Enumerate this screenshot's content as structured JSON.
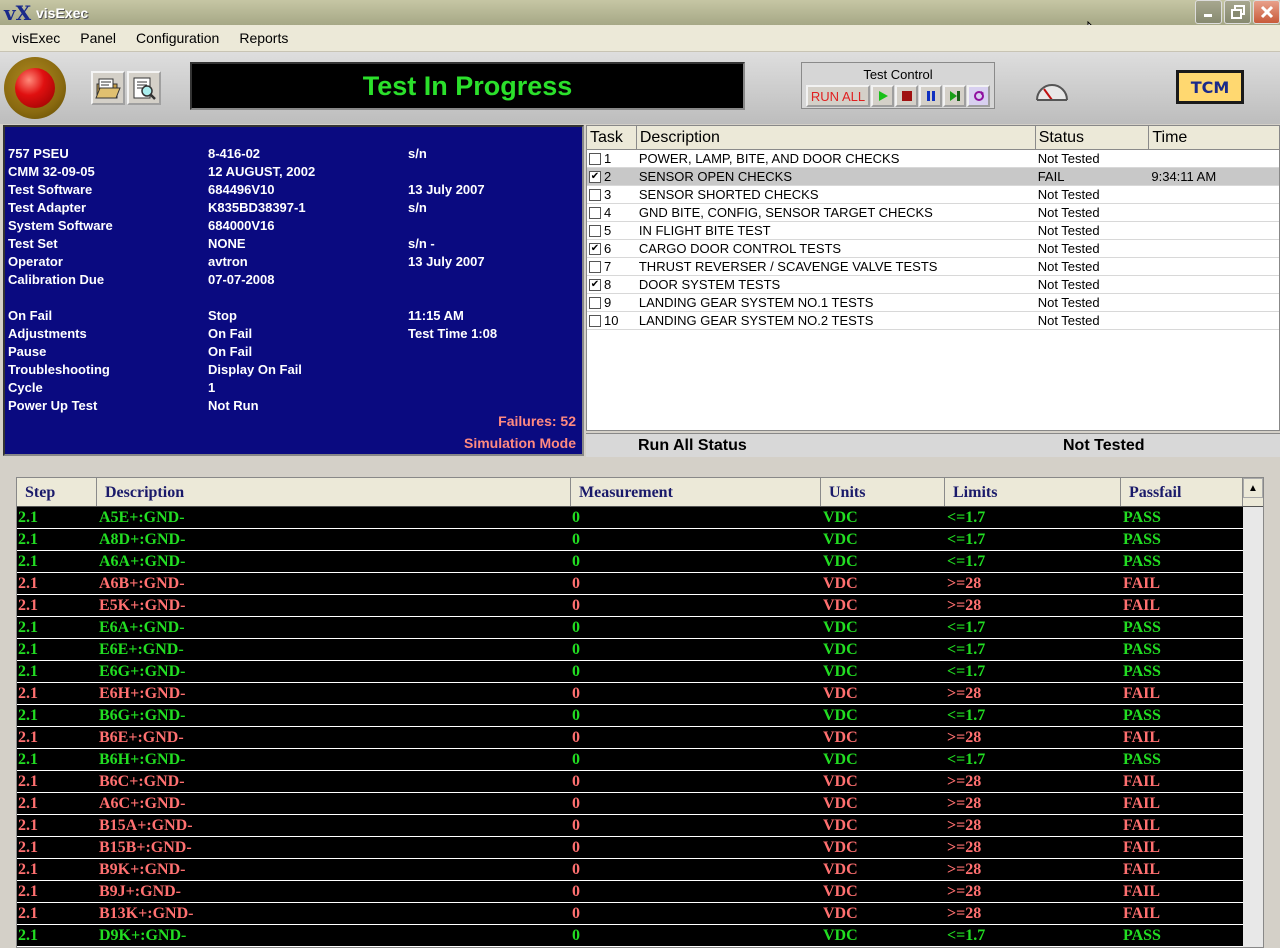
{
  "window": {
    "title": "visExec",
    "logo": "vX"
  },
  "menu": [
    "visExec",
    "Panel",
    "Configuration",
    "Reports"
  ],
  "toolbar": {
    "status_text": "Test In Progress",
    "test_control_title": "Test Control",
    "run_all_label": "RUN ALL",
    "tcm_label": "TCM"
  },
  "info": {
    "rows": [
      {
        "c1": "757 PSEU",
        "c2": "8-416-02",
        "c3": "s/n"
      },
      {
        "c1": "CMM 32-09-05",
        "c2": "12 AUGUST, 2002",
        "c3": ""
      },
      {
        "c1": "Test Software",
        "c2": "684496V10",
        "c3": "13 July  2007"
      },
      {
        "c1": "Test Adapter",
        "c2": "K835BD38397-1",
        "c3": "s/n"
      },
      {
        "c1": "System Software",
        "c2": "684000V16",
        "c3": ""
      },
      {
        "c1": "Test Set",
        "c2": "NONE",
        "c3": "s/n -"
      },
      {
        "c1": "Operator",
        "c2": "avtron",
        "c3": "13 July  2007"
      },
      {
        "c1": "Calibration Due",
        "c2": "07-07-2008",
        "c3": ""
      },
      {
        "c1": "On Fail",
        "c2": "Stop",
        "c3": "11:15 AM"
      },
      {
        "c1": "Adjustments",
        "c2": "On Fail",
        "c3": "Test Time  1:08"
      },
      {
        "c1": "Pause",
        "c2": "On Fail",
        "c3": ""
      },
      {
        "c1": "Troubleshooting",
        "c2": "Display On Fail",
        "c3": ""
      },
      {
        "c1": "Cycle",
        "c2": "1",
        "c3": ""
      },
      {
        "c1": "Power Up Test",
        "c2": "Not Run",
        "c3": ""
      }
    ],
    "failures": "Failures: 52",
    "mode": "Simulation Mode"
  },
  "tasks": {
    "headers": [
      "Task",
      "Description",
      "Status",
      "Time"
    ],
    "rows": [
      {
        "num": "1",
        "checked": false,
        "desc": "POWER, LAMP, BITE, AND DOOR CHECKS",
        "status": "Not Tested",
        "time": ""
      },
      {
        "num": "2",
        "checked": true,
        "desc": "SENSOR OPEN CHECKS",
        "status": "FAIL",
        "time": "9:34:11 AM",
        "selected": true
      },
      {
        "num": "3",
        "checked": false,
        "desc": "SENSOR SHORTED CHECKS",
        "status": "Not Tested",
        "time": ""
      },
      {
        "num": "4",
        "checked": false,
        "desc": "GND BITE, CONFIG, SENSOR TARGET CHECKS",
        "status": "Not Tested",
        "time": ""
      },
      {
        "num": "5",
        "checked": false,
        "desc": "IN FLIGHT BITE TEST",
        "status": "Not Tested",
        "time": ""
      },
      {
        "num": "6",
        "checked": true,
        "desc": "CARGO DOOR CONTROL TESTS",
        "status": "Not Tested",
        "time": ""
      },
      {
        "num": "7",
        "checked": false,
        "desc": "THRUST REVERSER / SCAVENGE VALVE TESTS",
        "status": "Not Tested",
        "time": ""
      },
      {
        "num": "8",
        "checked": true,
        "desc": "DOOR SYSTEM TESTS",
        "status": "Not Tested",
        "time": ""
      },
      {
        "num": "9",
        "checked": false,
        "desc": "LANDING GEAR SYSTEM NO.1 TESTS",
        "status": "Not Tested",
        "time": ""
      },
      {
        "num": "10",
        "checked": false,
        "desc": "LANDING GEAR SYSTEM NO.2 TESTS",
        "status": "Not Tested",
        "time": ""
      }
    ],
    "run_all_label": "Run All Status",
    "run_all_value": "Not Tested"
  },
  "steps": {
    "headers": [
      "Step",
      "Description",
      "Measurement",
      "Units",
      "Limits",
      "Passfail"
    ],
    "rows": [
      {
        "step": "2.1",
        "desc": "A5E+:GND-",
        "meas": "0",
        "units": "VDC",
        "limits": "<=1.7",
        "pf": "PASS"
      },
      {
        "step": "2.1",
        "desc": "A8D+:GND-",
        "meas": "0",
        "units": "VDC",
        "limits": "<=1.7",
        "pf": "PASS"
      },
      {
        "step": "2.1",
        "desc": "A6A+:GND-",
        "meas": "0",
        "units": "VDC",
        "limits": "<=1.7",
        "pf": "PASS"
      },
      {
        "step": "2.1",
        "desc": "A6B+:GND-",
        "meas": "0",
        "units": "VDC",
        "limits": ">=28",
        "pf": "FAIL"
      },
      {
        "step": "2.1",
        "desc": "E5K+:GND-",
        "meas": "0",
        "units": "VDC",
        "limits": ">=28",
        "pf": "FAIL"
      },
      {
        "step": "2.1",
        "desc": "E6A+:GND-",
        "meas": "0",
        "units": "VDC",
        "limits": "<=1.7",
        "pf": "PASS"
      },
      {
        "step": "2.1",
        "desc": "E6E+:GND-",
        "meas": "0",
        "units": "VDC",
        "limits": "<=1.7",
        "pf": "PASS"
      },
      {
        "step": "2.1",
        "desc": "E6G+:GND-",
        "meas": "0",
        "units": "VDC",
        "limits": "<=1.7",
        "pf": "PASS"
      },
      {
        "step": "2.1",
        "desc": "E6H+:GND-",
        "meas": "0",
        "units": "VDC",
        "limits": ">=28",
        "pf": "FAIL"
      },
      {
        "step": "2.1",
        "desc": "B6G+:GND-",
        "meas": "0",
        "units": "VDC",
        "limits": "<=1.7",
        "pf": "PASS"
      },
      {
        "step": "2.1",
        "desc": "B6E+:GND-",
        "meas": "0",
        "units": "VDC",
        "limits": ">=28",
        "pf": "FAIL"
      },
      {
        "step": "2.1",
        "desc": "B6H+:GND-",
        "meas": "0",
        "units": "VDC",
        "limits": "<=1.7",
        "pf": "PASS"
      },
      {
        "step": "2.1",
        "desc": "B6C+:GND-",
        "meas": "0",
        "units": "VDC",
        "limits": ">=28",
        "pf": "FAIL"
      },
      {
        "step": "2.1",
        "desc": "A6C+:GND-",
        "meas": "0",
        "units": "VDC",
        "limits": ">=28",
        "pf": "FAIL"
      },
      {
        "step": "2.1",
        "desc": "B15A+:GND-",
        "meas": "0",
        "units": "VDC",
        "limits": ">=28",
        "pf": "FAIL"
      },
      {
        "step": "2.1",
        "desc": "B15B+:GND-",
        "meas": "0",
        "units": "VDC",
        "limits": ">=28",
        "pf": "FAIL"
      },
      {
        "step": "2.1",
        "desc": "B9K+:GND-",
        "meas": "0",
        "units": "VDC",
        "limits": ">=28",
        "pf": "FAIL"
      },
      {
        "step": "2.1",
        "desc": "B9J+:GND-",
        "meas": "0",
        "units": "VDC",
        "limits": ">=28",
        "pf": "FAIL"
      },
      {
        "step": "2.1",
        "desc": "B13K+:GND-",
        "meas": "0",
        "units": "VDC",
        "limits": ">=28",
        "pf": "FAIL"
      },
      {
        "step": "2.1",
        "desc": "D9K+:GND-",
        "meas": "0",
        "units": "VDC",
        "limits": "<=1.7",
        "pf": "PASS"
      }
    ]
  },
  "colors": {
    "pass": "#22dd22",
    "fail": "#ff7070",
    "panel_blue": "#0a0a80",
    "status_green": "#2be02b"
  },
  "icons": [
    "vx-logo-icon",
    "minimize-icon",
    "maximize-icon",
    "close-icon",
    "emergency-stop-icon",
    "open-folder-icon",
    "find-report-icon",
    "play-icon",
    "stop-icon",
    "pause-icon",
    "step-icon",
    "repeat-icon",
    "gauge-icon",
    "scroll-up-icon"
  ]
}
